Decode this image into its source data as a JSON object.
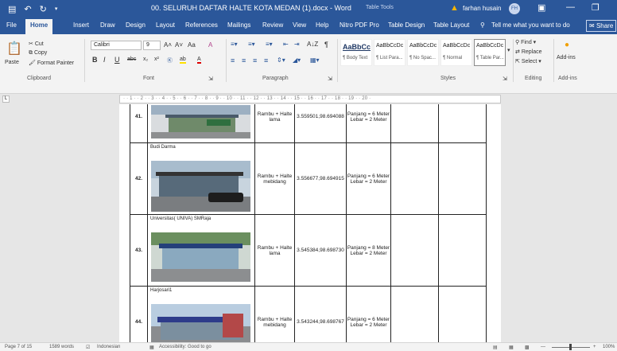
{
  "titlebar": {
    "undo_icon": "undo-icon",
    "redo_icon": "redo-icon",
    "doc_title": "00. SELURUH DAFTAR HALTE KOTA MEDAN (1).docx  -  Word",
    "context": "Table Tools",
    "user": "farhan husain",
    "avatar": "FH",
    "colors": {
      "brand": "#2b579a",
      "warning": "#f5b400"
    }
  },
  "tabs": [
    {
      "label": "File"
    },
    {
      "label": "Home",
      "active": true
    },
    {
      "label": "Insert"
    },
    {
      "label": "Draw"
    },
    {
      "label": "Design"
    },
    {
      "label": "Layout"
    },
    {
      "label": "References"
    },
    {
      "label": "Mailings"
    },
    {
      "label": "Review"
    },
    {
      "label": "View"
    },
    {
      "label": "Help"
    },
    {
      "label": "Nitro PDF Pro"
    },
    {
      "label": "Table Design"
    },
    {
      "label": "Table Layout"
    }
  ],
  "tell_me": "Tell me what you want to do",
  "share_label": "Share",
  "ribbon": {
    "clipboard": {
      "paste": "Paste",
      "cut": "Cut",
      "copy": "Copy",
      "format_painter": "Format Painter",
      "label": "Clipboard"
    },
    "font": {
      "name": "Calibri",
      "size": "9",
      "bold": "B",
      "italic": "I",
      "underline": "U",
      "strike": "abc",
      "sub": "x₂",
      "sup": "x²",
      "grow": "A˄",
      "shrink": "A˅",
      "case": "Aa",
      "clear": "A",
      "highlight": "ab",
      "color": "A",
      "label": "Font"
    },
    "paragraph": {
      "label": "Paragraph",
      "sort": "A↓Z",
      "pilcrow": "¶"
    },
    "styles": {
      "label": "Styles",
      "items": [
        {
          "sample": "AaBbCc",
          "name": "¶ Body Text",
          "bold": true
        },
        {
          "sample": "AaBbCcDc",
          "name": "¶ List Para..."
        },
        {
          "sample": "AaBbCcDc",
          "name": "¶ No Spac..."
        },
        {
          "sample": "AaBbCcDc",
          "name": "¶ Normal"
        },
        {
          "sample": "AaBbCcDc",
          "name": "¶ Table Par...",
          "selected": true
        }
      ]
    },
    "editing": {
      "find": "Find",
      "replace": "Replace",
      "select": "Select",
      "label": "Editing"
    },
    "addins": {
      "label": "Add-ins",
      "button": "Add-ins"
    }
  },
  "ruler_text": "· · 1 · · 2 · · 3 · · 4 · · 5 · · 6 · · 7 · · 8 · · 9 · · 10 · · 11 · · 12 · · 13 · · 14 · · 15 · · 16 · · 17 · · 18 · · 19 · · 20 ·",
  "rows": [
    {
      "num": "41.",
      "place": "",
      "type": "Rambu + Halte lama",
      "coord": "3.559501,98.694088",
      "size": "Panjang = 6 Meter Lebar = 2 Meter"
    },
    {
      "num": "42.",
      "place": "Budi Darma",
      "type": "Rambu + Halte mebidang",
      "coord": "3.556677,98.694915",
      "size": "Panjang = 6 Meter Lebar = 2 Meter"
    },
    {
      "num": "43.",
      "place": "Universitas( UNIVA)  SMRaja",
      "type": "Rambu + Halte lama",
      "coord": "3.545384,98.698730",
      "size": "Panjang = 8 Meter Lebar = 2 Meter"
    },
    {
      "num": "44.",
      "place": "Harjosari1",
      "type": "Rambu + Halte mebidang",
      "coord": "3.543244,98.698767",
      "size": "Panjang = 6 Meter Lebar = 2 Meter"
    }
  ],
  "status": {
    "page": "Page 7 of 15",
    "words": "1589 words",
    "language": "Indonesian",
    "accessibility": "Accessibility: Good to go",
    "zoom": "100%"
  }
}
